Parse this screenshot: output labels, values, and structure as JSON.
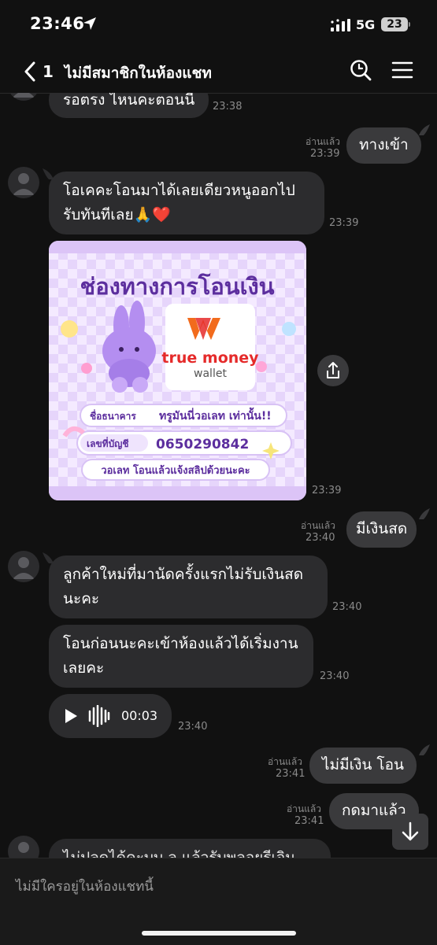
{
  "status": {
    "time": "23:46",
    "network": "5G",
    "battery": "23"
  },
  "header": {
    "back_count": "1",
    "title": "ไม่มีสมาชิกในห้องแชท"
  },
  "messages": {
    "m1": {
      "text": "รอตรง ไหนคะตอนนี้",
      "time": "23:38"
    },
    "m2": {
      "text": "ทางเข้า",
      "read": "อ่านแล้ว",
      "time": "23:39"
    },
    "m3": {
      "line1": "โอเคคะโอนมาได้เลยเดียวหนูออกไป",
      "line2": "รับทันทีเลย🙏❤️",
      "time": "23:39"
    },
    "m4": {
      "time": "23:39",
      "image": {
        "title": "ช่องทางการโอนเงิน",
        "brand_line1": "true money",
        "brand_line2": "wallet",
        "bank_label": "ชื่อธนาคาร",
        "bank_value": "ทรูมันนี่วอเลท เท่านั้น!!",
        "account_label": "เลขที่บัญชี",
        "account_value": "0650290842",
        "note": "วอเลท โอนแล้วแจ้งสลิปด้วยนะคะ"
      }
    },
    "m5": {
      "text": "มีเงินสด",
      "read": "อ่านแล้ว",
      "time": "23:40"
    },
    "m6": {
      "line1": "ลูกค้าใหม่ที่มานัดครั้งแรกไม่รับเงินสด",
      "line2": "นะคะ",
      "time": "23:40"
    },
    "m7": {
      "line1": "โอนก่อนนะคะเข้าห้องแล้วได้เริ่มงาน",
      "line2": "เลยคะ",
      "time": "23:40"
    },
    "m8": {
      "duration": "00:03",
      "time": "23:40"
    },
    "m9": {
      "text": "ไม่มีเงิน โอน",
      "read": "อ่านแล้ว",
      "time": "23:41"
    },
    "m10": {
      "text": "กดมาแล้ว",
      "read": "อ่านแล้ว",
      "time": "23:41"
    },
    "m11": {
      "text": "ไม่ปลดได้คะบบ ล แล้วรับพลอยรีเจิน"
    }
  },
  "footer": {
    "text": "ไม่มีใครอยู่ในห้องแชทนี้"
  },
  "colors": {
    "background": "#111111",
    "bubble_in": "#2c2c2e",
    "bubble_out": "#3a3a3c",
    "brand_orange": "#f26b1d",
    "brand_red": "#e52a2a",
    "card_purple": "#5c2e9e"
  }
}
